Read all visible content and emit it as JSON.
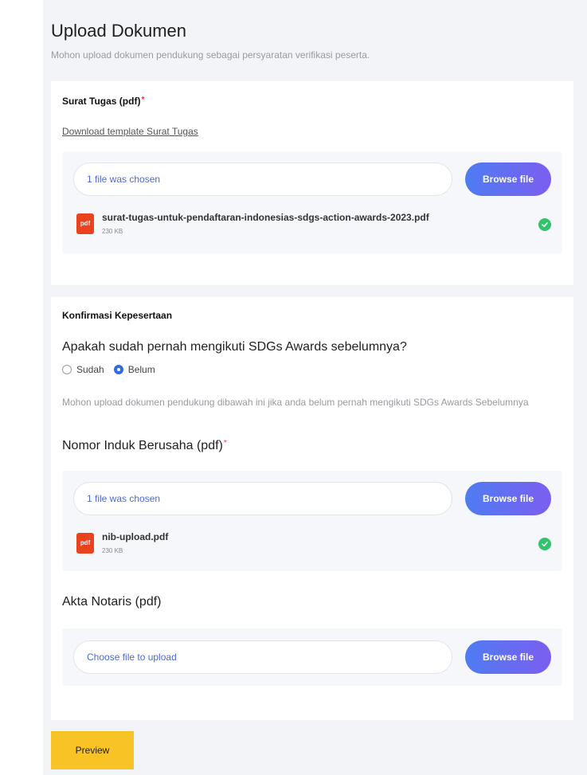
{
  "page": {
    "title": "Upload Dokumen",
    "subtitle": "Mohon upload dokumen pendukung sebagai persyaratan verifikasi peserta."
  },
  "surat_tugas": {
    "label": "Surat Tugas (pdf)",
    "required_mark": "*",
    "template_link": "Download template Surat Tugas",
    "input_text": "1 file was chosen",
    "browse_label": "Browse file",
    "file": {
      "icon_text": "pdf",
      "name": "surat-tugas-untuk-pendaftaran-indonesias-sdgs-action-awards-2023.pdf",
      "size": "230 KB"
    }
  },
  "konfirmasi": {
    "title": "Konfirmasi Kepesertaan",
    "question": "Apakah sudah pernah mengikuti SDGs Awards sebelumnya?",
    "options": [
      {
        "label": "Sudah",
        "selected": false
      },
      {
        "label": "Belum",
        "selected": true
      }
    ],
    "hint": "Mohon upload dokumen pendukung dibawah ini jika anda belum pernah mengikuti SDGs Awards Sebelumnya"
  },
  "nib": {
    "label": "Nomor Induk Berusaha (pdf)",
    "required_mark": "*",
    "input_text": "1 file was chosen",
    "browse_label": "Browse file",
    "file": {
      "icon_text": "pdf",
      "name": "nib-upload.pdf",
      "size": "230 KB"
    }
  },
  "akta": {
    "label": "Akta Notaris (pdf)",
    "input_placeholder": "Choose file to upload",
    "browse_label": "Browse file"
  },
  "preview_label": "Preview",
  "colors": {
    "accent_blue": "#2f6be3",
    "success_green": "#33c36e",
    "pdf_red": "#e8421f",
    "preview_yellow": "#f7c325"
  }
}
